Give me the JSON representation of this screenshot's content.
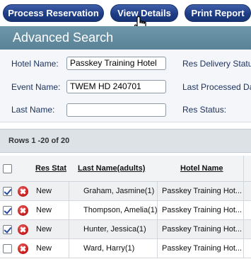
{
  "toolbar": {
    "process_label": "Process Reservation",
    "view_label": "View Details",
    "print_label": "Print Report"
  },
  "search": {
    "title": "Advanced Search",
    "hotel_name_label": "Hotel Name:",
    "hotel_name_value": "Passkey Training Hotel",
    "event_name_label": "Event Name:",
    "event_name_value": "TWEM HD 240701",
    "last_name_label": "Last Name:",
    "last_name_value": "",
    "res_delivery_label": "Res Delivery Statu",
    "last_processed_label": "Last Processed Da",
    "res_status_label": "Res Status:"
  },
  "grid": {
    "rows_label": "Rows 1 -20 of 20",
    "columns": [
      "Res Stat",
      "Last Name(adults)",
      "Hotel Name"
    ],
    "rows": [
      {
        "checked": true,
        "status": "New",
        "last_name": "Graham, Jasmine(1)",
        "hotel": "Passkey Training Hot..."
      },
      {
        "checked": true,
        "status": "New",
        "last_name": "Thompson, Amelia(1)",
        "hotel": "Passkey Training Hot..."
      },
      {
        "checked": true,
        "status": "New",
        "last_name": "Hunter, Jessica(1)",
        "hotel": "Passkey Training Hot..."
      },
      {
        "checked": false,
        "status": "New",
        "last_name": "Ward, Harry(1)",
        "hotel": "Passkey Training Hot..."
      }
    ]
  },
  "icons": {
    "delete": "delete-icon",
    "cursor": "hand-pointer-icon"
  },
  "colors": {
    "button_bg": "#1e3d86",
    "header_bar": "#5a8296",
    "label_text": "#1d3360",
    "delete_red": "#c41818"
  }
}
